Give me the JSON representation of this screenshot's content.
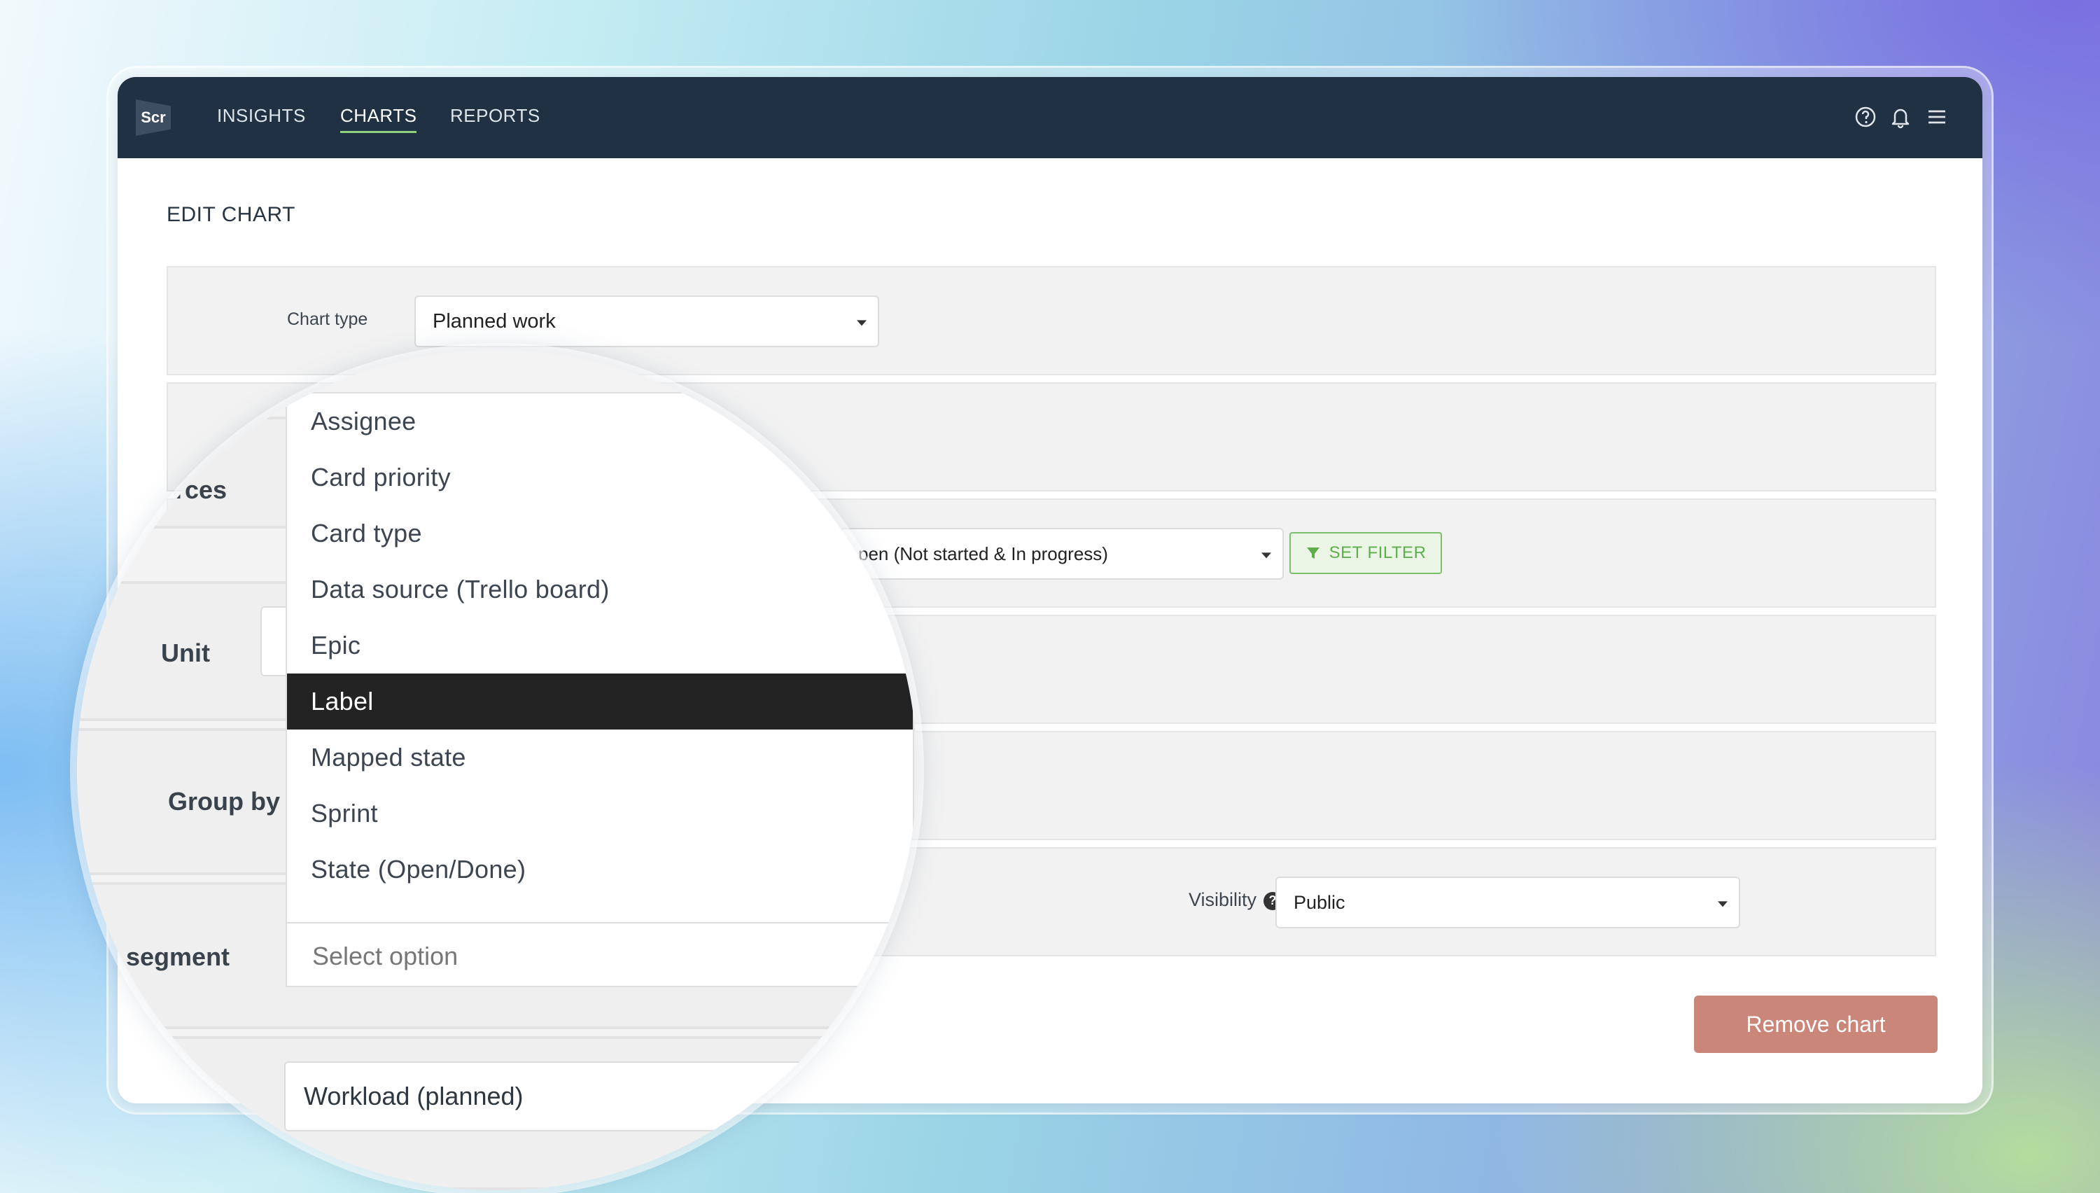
{
  "nav": {
    "logo": "Scr",
    "items": [
      {
        "label": "INSIGHTS"
      },
      {
        "label": "CHARTS"
      },
      {
        "label": "REPORTS"
      }
    ],
    "active": "CHARTS"
  },
  "page_title": "EDIT CHART",
  "form": {
    "chart_type_label": "Chart type",
    "chart_type_value": "Planned work",
    "state_filter_value": "pen (Not started & In progress)",
    "set_filter_label": "SET FILTER",
    "visibility_label": "Visibility",
    "visibility_value": "Public",
    "remove_chart_label": "Remove chart"
  },
  "magnifier": {
    "labels": {
      "sources": "ırces",
      "unit": "Unit",
      "group_by": "Group by",
      "segment": "segment"
    },
    "dropdown": {
      "items": [
        "Assignee",
        "Card priority",
        "Card type",
        "Data source (Trello board)",
        "Epic",
        "Label",
        "Mapped state",
        "Sprint",
        "State (Open/Done)"
      ],
      "selected": "Label",
      "search_placeholder": "Select option"
    },
    "metric_value": "Workload (planned)"
  },
  "colors": {
    "navbar": "#1f3142",
    "active_underline": "#8fcf7d",
    "filter_green": "#5fae4c",
    "remove_button": "#c98679"
  }
}
